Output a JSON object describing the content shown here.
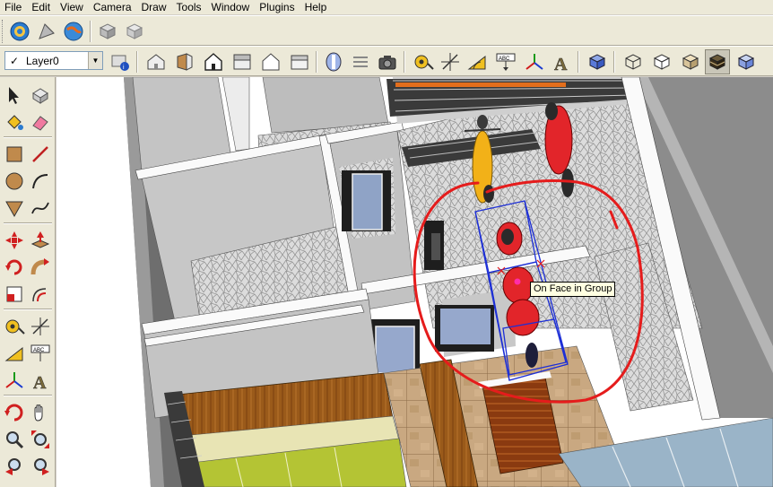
{
  "menu": [
    "File",
    "Edit",
    "View",
    "Camera",
    "Draw",
    "Tools",
    "Window",
    "Plugins",
    "Help"
  ],
  "toolbar1_icons": [
    "get-models-icon",
    "share-model-icon",
    "earth-icon",
    "components-icon",
    "materials-icon"
  ],
  "layer": {
    "checked": "✓",
    "name": "Layer0"
  },
  "toolbar2_icons": [
    "layer-manager-icon",
    "iso-view-icon",
    "top-view-icon",
    "front-view-icon",
    "right-view-icon",
    "back-view-icon",
    "left-view-icon",
    "xray-icon",
    "section-plane-icon",
    "camera-icon",
    "tape-measure-icon",
    "dimension-icon",
    "protractor-icon",
    "text-icon",
    "axes-icon",
    "3d-text-icon",
    "xray-mode-icon",
    "wireframe-icon",
    "hidden-line-icon",
    "shaded-icon",
    "textured-icon",
    "monochrome-icon"
  ],
  "tools": [
    "select-icon",
    "make-component-icon",
    "paint-bucket-icon",
    "eraser-icon",
    "rectangle-icon",
    "line-icon",
    "circle-icon",
    "arc-icon",
    "polygon-icon",
    "freehand-icon",
    "move-icon",
    "push-pull-icon",
    "rotate-icon",
    "follow-me-icon",
    "scale-icon",
    "offset-icon",
    "tape-measure-icon",
    "dimension-icon",
    "protractor-icon",
    "text-icon",
    "axes-icon",
    "3d-text-icon",
    "orbit-icon",
    "pan-icon",
    "zoom-icon",
    "zoom-extents-icon",
    "previous-view-icon",
    "next-view-icon"
  ],
  "tooltip": "On Face in Group",
  "colors": {
    "annotation": "#e51c1c",
    "selection": "#1d2fd6",
    "paving": "#d8d8d8",
    "wall": "#ffffff",
    "floor": "#c8c8c8",
    "wood": "#9a5a1a"
  },
  "toolbar1_label": "",
  "toolbar2_label": ""
}
